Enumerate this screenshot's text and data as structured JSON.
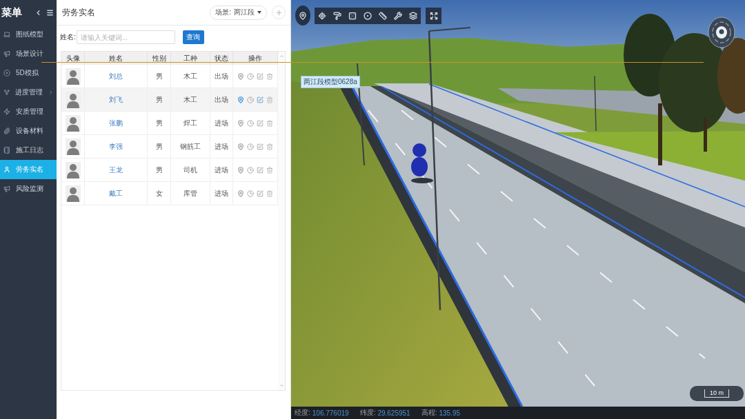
{
  "sidebar": {
    "title": "菜单",
    "items": [
      {
        "label": "图纸模型",
        "selected": false,
        "expandable": false
      },
      {
        "label": "场景设计",
        "selected": false,
        "expandable": false
      },
      {
        "label": "5D模拟",
        "selected": false,
        "expandable": false
      },
      {
        "label": "进度管理",
        "selected": false,
        "expandable": true
      },
      {
        "label": "安质管理",
        "selected": false,
        "expandable": false
      },
      {
        "label": "设备材料",
        "selected": false,
        "expandable": false
      },
      {
        "label": "施工日志",
        "selected": false,
        "expandable": false
      },
      {
        "label": "劳务实名",
        "selected": true,
        "expandable": false
      },
      {
        "label": "风险监测",
        "selected": false,
        "expandable": false
      }
    ]
  },
  "panel": {
    "title": "劳务实名",
    "scene_label": "场景:",
    "scene_value": "两江段"
  },
  "search": {
    "label": "姓名:",
    "placeholder": "请输入关键词...",
    "button": "查询"
  },
  "table": {
    "columns": [
      "头像",
      "姓名",
      "性别",
      "工种",
      "状态",
      "操作"
    ],
    "rows": [
      {
        "name": "刘总",
        "gender": "男",
        "trade": "木工",
        "status": "出场",
        "highlighted": false
      },
      {
        "name": "刘飞",
        "gender": "男",
        "trade": "木工",
        "status": "出场",
        "highlighted": true
      },
      {
        "name": "张鹏",
        "gender": "男",
        "trade": "焊工",
        "status": "进场",
        "highlighted": false
      },
      {
        "name": "李强",
        "gender": "男",
        "trade": "钢筋工",
        "status": "进场",
        "highlighted": false
      },
      {
        "name": "王龙",
        "gender": "男",
        "trade": "司机",
        "status": "进场",
        "highlighted": false
      },
      {
        "name": "戴工",
        "gender": "女",
        "trade": "库管",
        "status": "进场",
        "highlighted": false
      }
    ]
  },
  "viewport": {
    "model_label": "两江段模型0628a",
    "scale": "10 m",
    "status_bar": [
      {
        "label": "经度:",
        "value": "106.776019"
      },
      {
        "label": "纬度:",
        "value": "29.625951"
      },
      {
        "label": "高程:",
        "value": "135.95"
      }
    ]
  }
}
